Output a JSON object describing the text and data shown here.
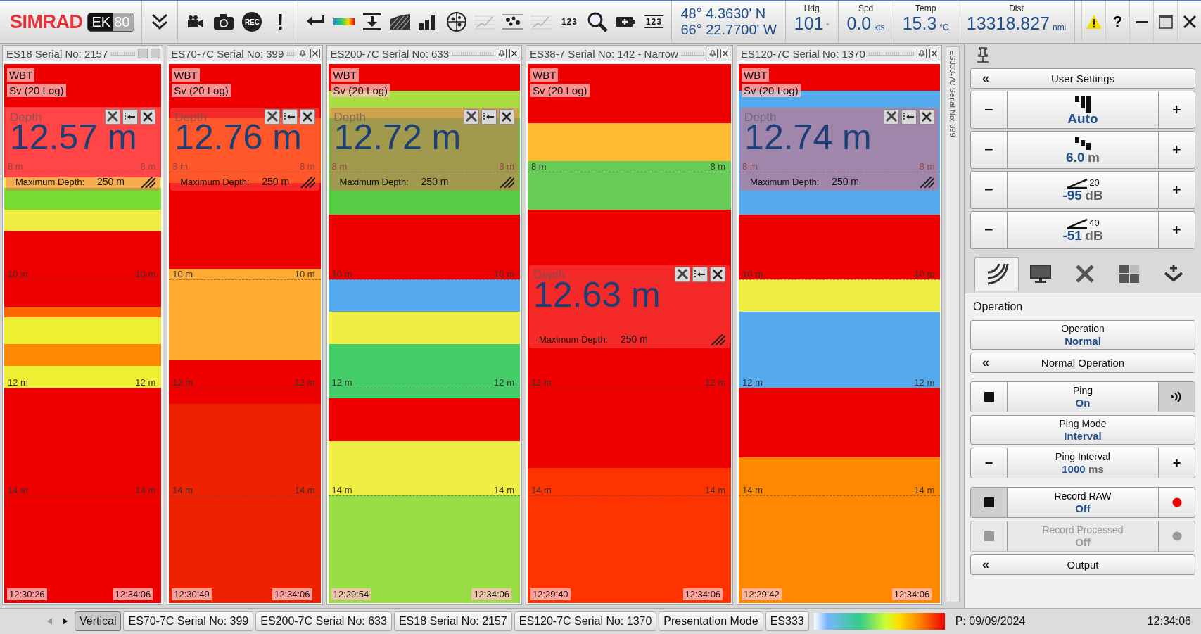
{
  "toolbar": {
    "logo": {
      "brand": "SIMRAD",
      "model_a": "EK",
      "model_b": "80"
    },
    "groups": [
      [
        {
          "kind": "chevrons",
          "disabled": false
        }
      ],
      [
        {
          "kind": "camcorder",
          "disabled": false
        },
        {
          "kind": "camera",
          "disabled": false
        },
        {
          "kind": "rec",
          "label": "REC",
          "disabled": false
        },
        {
          "kind": "alert",
          "label": "!",
          "disabled": false
        }
      ],
      [
        {
          "kind": "return",
          "disabled": false
        },
        {
          "kind": "colorbar",
          "disabled": false
        },
        {
          "kind": "download",
          "disabled": false
        },
        {
          "kind": "hatch",
          "disabled": false
        },
        {
          "kind": "bars",
          "disabled": false
        },
        {
          "kind": "target",
          "disabled": false
        },
        {
          "kind": "linechart",
          "disabled": true
        },
        {
          "kind": "dots",
          "disabled": false
        },
        {
          "kind": "linechart",
          "disabled": true
        },
        {
          "kind": "numlines",
          "label": "123",
          "disabled": false
        },
        {
          "kind": "magnifier",
          "disabled": false
        },
        {
          "kind": "battery",
          "disabled": false
        },
        {
          "kind": "numbox",
          "label": "123",
          "disabled": false
        }
      ]
    ],
    "position": {
      "lat": "48° 4.3630' N",
      "lon": "66° 22.7700' W"
    },
    "readouts": [
      {
        "label": "Hdg",
        "value": "101",
        "unit": "˚"
      },
      {
        "label": "Spd",
        "value": "0.0",
        "unit": "kts"
      },
      {
        "label": "Temp",
        "value": "15.3",
        "unit": "°C"
      },
      {
        "label": "Dist",
        "value": "13318.827",
        "unit": "nmi"
      }
    ],
    "window_buttons": [
      {
        "kind": "warning"
      },
      {
        "kind": "help",
        "label": "?"
      },
      {
        "kind": "minimize"
      },
      {
        "kind": "maximize"
      },
      {
        "kind": "close"
      }
    ]
  },
  "panels": [
    {
      "title": "ES18 Serial No: 2157",
      "buttons_disabled": true,
      "labels": [
        "WBT",
        "Sv (20 Log)"
      ],
      "depth": {
        "label": "Depth",
        "value": "12.57 m",
        "max_label": "Maximum Depth:",
        "max_value": "250 m"
      },
      "ticks": [
        {
          "left": "8 m",
          "right": "8 m",
          "dashed": true
        },
        {
          "left": "10 m",
          "right": "10 m",
          "dashed": true
        },
        {
          "left": "12 m",
          "right": "12 m",
          "dashed": true
        },
        {
          "left": "14 m",
          "right": "14 m",
          "dashed": true
        }
      ],
      "start_time": "12:30:26",
      "end_time": "12:34:06"
    },
    {
      "title": "ES70-7C Serial No: 399",
      "buttons_disabled": false,
      "labels": [
        "WBT",
        "Sv (20 Log)"
      ],
      "depth": {
        "label": "Depth",
        "value": "12.76 m",
        "max_label": "Maximum Depth:",
        "max_value": "250 m"
      },
      "ticks": [
        {
          "left": "8 m",
          "right": "8 m",
          "dashed": true
        },
        {
          "left": "10 m",
          "right": "10 m",
          "dashed": true
        },
        {
          "left": "12 m",
          "right": "12 m",
          "dashed": true
        },
        {
          "left": "14 m",
          "right": "14 m",
          "dashed": true
        }
      ],
      "start_time": "12:30:49",
      "end_time": "12:34:06"
    },
    {
      "title": "ES200-7C Serial No: 633",
      "buttons_disabled": false,
      "labels": [
        "WBT",
        "Sv (20 Log)"
      ],
      "depth": {
        "label": "Depth",
        "value": "12.72 m",
        "max_label": "Maximum Depth:",
        "max_value": "250 m"
      },
      "ticks": [
        {
          "left": "8 m",
          "right": "8 m",
          "dashed": true
        },
        {
          "left": "10 m",
          "right": "10 m",
          "dashed": true
        },
        {
          "left": "12 m",
          "right": "12 m",
          "dashed": true
        },
        {
          "left": "14 m",
          "right": "14 m",
          "dashed": true
        }
      ],
      "start_time": "12:29:54",
      "end_time": "12:34:06"
    },
    {
      "title": "ES38-7 Serial No: 142 - Narrow",
      "buttons_disabled": false,
      "labels": [
        "WBT",
        "Sv (20 Log)"
      ],
      "depth": {
        "label": "Depth",
        "value": "12.63 m",
        "max_label": "Maximum Depth:",
        "max_value": "250 m"
      },
      "ticks": [
        {
          "left": "8 m",
          "right": "8 m",
          "dashed": true
        },
        {
          "dashed": true
        },
        {
          "left": "12 m",
          "right": "12 m",
          "dashed": true
        },
        {
          "left": "14 m",
          "right": "14 m",
          "dashed": true
        }
      ],
      "start_time": "12:29:40",
      "end_time": "12:34:06"
    },
    {
      "title": "ES120-7C Serial No: 1370",
      "buttons_disabled": false,
      "labels": [
        "WBT",
        "Sv (20 Log)"
      ],
      "depth": {
        "label": "Depth",
        "value": "12.74 m",
        "max_label": "Maximum Depth:",
        "max_value": "250 m"
      },
      "ticks": [
        {
          "left": "8 m",
          "right": "8 m",
          "dashed": true
        },
        {
          "left": "10 m",
          "right": "10 m",
          "dashed": true
        },
        {
          "left": "12 m",
          "right": "12 m",
          "dashed": true
        },
        {
          "left": "14 m",
          "right": "14 m",
          "dashed": true
        }
      ],
      "start_time": "12:29:42",
      "end_time": "12:34:06"
    }
  ],
  "side_tab": {
    "title": "ES333-7C Serial No: 399"
  },
  "side_panel": {
    "user_settings": {
      "chevron": "«",
      "label": "User Settings"
    },
    "steppers": [
      {
        "minus": "−",
        "plus": "+",
        "value": "Auto"
      },
      {
        "minus": "−",
        "plus": "+",
        "value": "6.0",
        "unit": "m"
      },
      {
        "exponent": "20",
        "minus": "−",
        "plus": "+",
        "value": "-95",
        "unit": "dB"
      },
      {
        "exponent": "40",
        "minus": "−",
        "plus": "+",
        "value": "-51",
        "unit": "dB"
      }
    ],
    "tabs": [
      {
        "selected": true
      },
      {
        "selected": false
      },
      {
        "selected": false
      },
      {
        "selected": false
      },
      {
        "selected": false
      }
    ],
    "section_title": "Operation",
    "control_groups": [
      [
        {
          "kind": "value",
          "label": "Operation",
          "value": "Normal"
        },
        {
          "kind": "expander",
          "chevron": "«",
          "label": "Normal Operation"
        }
      ],
      [
        {
          "kind": "ping",
          "label": "Ping",
          "value": "On",
          "left_pressed": false,
          "right_pressed": true,
          "disabled": false
        },
        {
          "kind": "value",
          "label": "Ping Mode",
          "value": "Interval"
        },
        {
          "kind": "stepper",
          "minus": "−",
          "plus": "+",
          "label": "Ping Interval",
          "value": "1000",
          "unit": "ms"
        }
      ],
      [
        {
          "kind": "record",
          "label": "Record RAW",
          "value": "Off",
          "left_pressed": true,
          "right_pressed": false,
          "disabled": false
        },
        {
          "kind": "record",
          "label": "Record Processed",
          "value": "Off",
          "left_pressed": false,
          "right_pressed": false,
          "disabled": true
        },
        {
          "kind": "expander",
          "chevron": "«",
          "label": "Output"
        }
      ]
    ]
  },
  "bottom_bar": {
    "prev_disabled": true,
    "tabs": [
      {
        "label": "Vertical",
        "selected": true
      },
      {
        "label": "ES70-7C Serial No: 399",
        "selected": false
      },
      {
        "label": "ES200-7C Serial No: 633",
        "selected": false
      },
      {
        "label": "ES18 Serial No: 2157",
        "selected": false
      },
      {
        "label": "ES120-7C Serial No: 1370",
        "selected": false
      },
      {
        "label": "Presentation Mode",
        "selected": false
      },
      {
        "label": "ES333",
        "selected": false
      }
    ],
    "date": "P: 09/09/2024",
    "time": "12:34:06"
  }
}
